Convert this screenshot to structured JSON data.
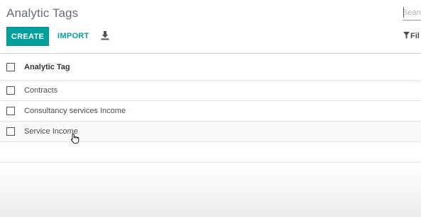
{
  "header": {
    "title": "Analytic Tags"
  },
  "search": {
    "placeholder": "Search"
  },
  "toolbar": {
    "create_label": "CREATE",
    "import_label": "IMPORT",
    "download_icon": "download-icon"
  },
  "filters": {
    "label": "Fil",
    "icon": "filter-icon"
  },
  "list": {
    "column_header": "Analytic Tag",
    "rows": [
      {
        "name": "Contracts"
      },
      {
        "name": "Consultancy services Income"
      },
      {
        "name": "Service Income"
      }
    ]
  },
  "colors": {
    "accent": "#00a09d",
    "title": "#666d77",
    "text": "#4c4c4c"
  }
}
